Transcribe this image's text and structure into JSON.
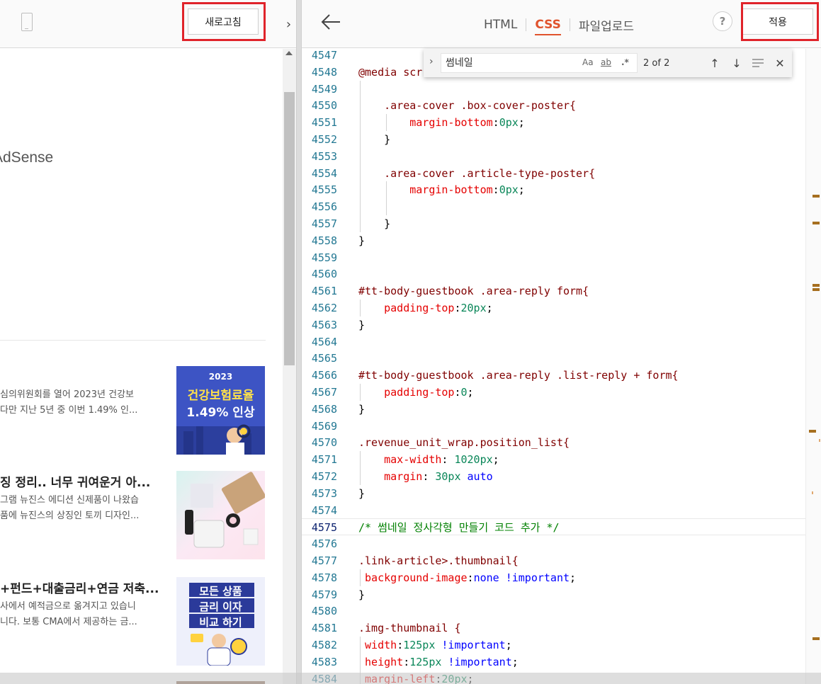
{
  "preview": {
    "refresh_label": "새로고침",
    "adsense_text": "AdSense",
    "posts": [
      {
        "title": "",
        "excerpt_1": "심의위원회를 열어 2023년 건강보",
        "excerpt_2": "다만 지난 5년 중 이번 1.49% 인...",
        "thumb_top_text": "2023",
        "thumb_line1": "건강보험료율",
        "thumb_line2": "1.49% 인상"
      },
      {
        "title": "징 정리.. 너무 귀여운거 아...",
        "excerpt_1": "그램 뉴진스 에디션 신제품이 나왔습",
        "excerpt_2": "품에 뉴진스의 상징인 토끼 디자인..."
      },
      {
        "title": "+펀드+대출금리+연금 저축...",
        "excerpt_1": "사에서 예적금으로 옮겨지고 있습니",
        "excerpt_2": "니다. 보통 CMA에서 제공하는 금...",
        "thumb_line1": "모든 상품",
        "thumb_line2": "금리 이자",
        "thumb_line3": "비교 하기"
      }
    ]
  },
  "editor": {
    "tabs": [
      "HTML",
      "CSS",
      "파일업로드"
    ],
    "active_tab": "CSS",
    "help_label": "?",
    "apply_label": "적용",
    "find": {
      "query": "썸네일",
      "opt_case": "Aa",
      "opt_word": "ab",
      "opt_regex": ".*",
      "count": "2 of 2"
    },
    "first_line_number": 4547,
    "current_line": 4575,
    "lines": [
      "",
      "@media scr",
      "",
      "    .area-cover .box-cover-poster{",
      "        margin-bottom:0px;",
      "    }",
      "",
      "    .area-cover .article-type-poster{",
      "        margin-bottom:0px;",
      "",
      "    }",
      "}",
      "",
      "",
      "#tt-body-guestbook .area-reply form{",
      "    padding-top:20px;",
      "}",
      "",
      "",
      "#tt-body-guestbook .area-reply .list-reply + form{",
      "    padding-top:0;",
      "}",
      "",
      ".revenue_unit_wrap.position_list{",
      "    max-width: 1020px;",
      "    margin: 30px auto",
      "}",
      "",
      "/* 썸네일 정사각형 만들기 코드 추가 */",
      "",
      ".link-article>.thumbnail{",
      " background-image:none !important;",
      "}",
      "",
      ".img-thumbnail {",
      " width:125px !important;",
      " height:125px !important;",
      " margin-left:20px;"
    ],
    "colors": {
      "selector": "#800000",
      "property": "#e50000",
      "number": "#098658",
      "keyword": "#0000ff",
      "comment": "#008000",
      "line_number": "#237893",
      "active_tab": "#e0532d",
      "highlight_frame": "#e0232a"
    }
  }
}
